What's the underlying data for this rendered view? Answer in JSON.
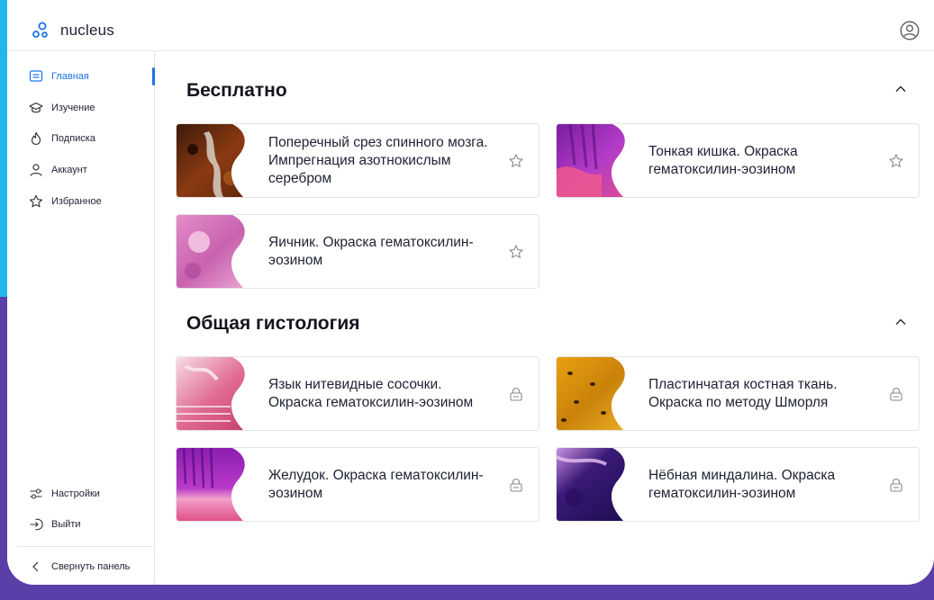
{
  "app": {
    "name": "nucleus"
  },
  "sidebar": {
    "items": [
      {
        "label": "Главная",
        "icon": "home-icon"
      },
      {
        "label": "Изучение",
        "icon": "graduation-cap-icon"
      },
      {
        "label": "Подписка",
        "icon": "flame-icon"
      },
      {
        "label": "Аккаунт",
        "icon": "user-icon"
      },
      {
        "label": "Избранное",
        "icon": "star-icon"
      }
    ],
    "bottom": [
      {
        "label": "Настройки",
        "icon": "settings-sliders-icon"
      },
      {
        "label": "Выйти",
        "icon": "logout-icon"
      }
    ],
    "collapse_label": "Свернуть панель"
  },
  "sections": [
    {
      "title": "Бесплатно",
      "cards": [
        {
          "title": "Поперечный срез спинного мозга. Импрегнация азотнокислым серебром",
          "icon": "star-icon"
        },
        {
          "title": "Тонкая кишка. Окраска гематоксилин-эозином",
          "icon": "star-icon"
        },
        {
          "title": "Яичник. Окраска гематоксилин-эозином",
          "icon": "star-icon"
        }
      ]
    },
    {
      "title": "Общая гистология",
      "cards": [
        {
          "title": "Язык нитевидные сосочки. Окраска гематоксилин-эозином",
          "icon": "lock-icon"
        },
        {
          "title": "Пластинчатая костная ткань. Окраска по методу Шморля",
          "icon": "lock-icon"
        },
        {
          "title": "Желудок. Окраска гематоксилин-эозином",
          "icon": "lock-icon"
        },
        {
          "title": "Нёбная миндалина. Окраска гематоксилин-эозином",
          "icon": "lock-icon"
        }
      ]
    }
  ],
  "colors": {
    "accent": "#1a73e8",
    "background_purple": "#5b3fa8",
    "background_cyan": "#22b6ee"
  }
}
